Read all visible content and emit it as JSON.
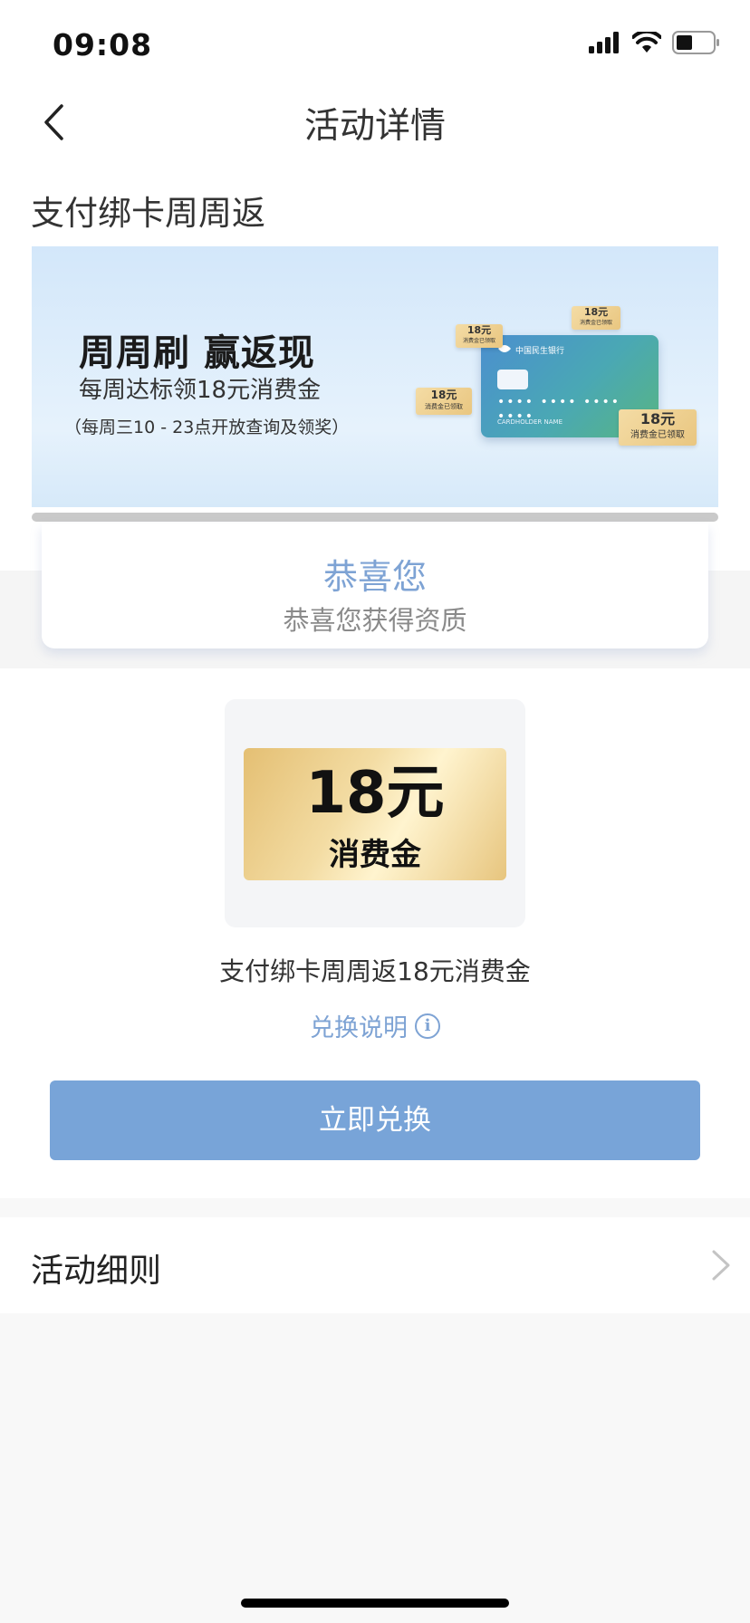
{
  "status_bar": {
    "time": "09:08"
  },
  "nav": {
    "title": "活动详情"
  },
  "activity": {
    "title": "支付绑卡周周返"
  },
  "banner": {
    "headline": "周周刷 赢返现",
    "subhead": "每周达标领18元消费金",
    "note": "（每周三10 - 23点开放查询及领奖）",
    "bank_name": "中国民生银行",
    "card_number": "•••• •••• •••• ••••",
    "card_holder": "CARDHOLDER NAME",
    "tag_amount": "18元",
    "tag_status": "消费金已领取"
  },
  "congrats": {
    "title": "恭喜您",
    "subtitle": "恭喜您获得资质"
  },
  "coupon": {
    "amount": "18元",
    "label": "消费金",
    "name": "支付绑卡周周返18元消费金"
  },
  "exchange_info": {
    "label": "兑换说明",
    "icon": "info-icon"
  },
  "redeem_button": {
    "label": "立即兑换"
  },
  "rules": {
    "label": "活动细则"
  },
  "colors": {
    "accent": "#78a4d8",
    "accent_text": "#7ea3d4",
    "background": "#f8f8f8"
  }
}
